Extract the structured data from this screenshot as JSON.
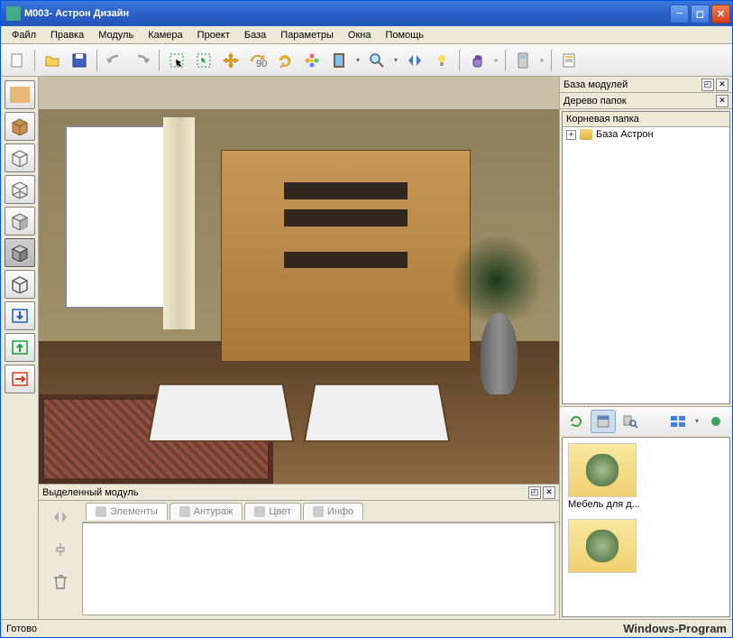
{
  "window": {
    "title": "M003- Астрон Дизайн"
  },
  "menu": {
    "items": [
      "Файл",
      "Правка",
      "Модуль",
      "Камера",
      "Проект",
      "База",
      "Параметры",
      "Окна",
      "Помощь"
    ]
  },
  "toolbar": {
    "icons": [
      "new-icon",
      "open-icon",
      "save-icon",
      "undo-icon",
      "redo-icon",
      "select-icon",
      "select-add-icon",
      "move-icon",
      "rotate90-icon",
      "rotate-icon",
      "flower-icon",
      "mirror-icon",
      "zoom-icon",
      "flip-icon",
      "light-icon",
      "hand-icon",
      "more-icon",
      "phone-icon",
      "more-icon",
      "page-icon"
    ]
  },
  "leftTools": [
    "texture-tool",
    "box-tool",
    "wireframe-tool",
    "wireframe2-tool",
    "box2-tool",
    "edge-tool",
    "iso-tool",
    "import-tool",
    "export-tool",
    "next-tool"
  ],
  "panels": {
    "selected": {
      "title": "Выделенный модуль"
    },
    "tabs": {
      "elements": "Элементы",
      "entourage": "Антураж",
      "color": "Цвет",
      "info": "Инфо"
    },
    "modules": {
      "title": "База модулей"
    },
    "tree": {
      "title": "Дерево папок",
      "root": "Корневая папка",
      "node1": "База Астрон"
    }
  },
  "thumbs": {
    "item1": "Мебель для д..."
  },
  "status": {
    "text": "Готово"
  },
  "watermark": "Windows-Program"
}
